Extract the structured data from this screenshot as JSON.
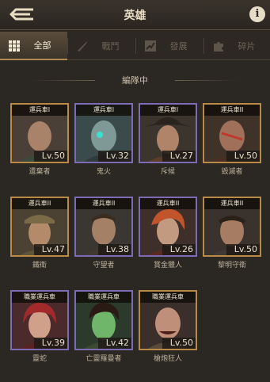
{
  "header": {
    "title": "英雄",
    "info": "i"
  },
  "tabs": [
    {
      "label": "全部",
      "icon": "grid-icon",
      "active": true
    },
    {
      "label": "戰鬥",
      "icon": "sword-icon",
      "active": false
    },
    {
      "label": "發展",
      "icon": "chart-icon",
      "active": false
    },
    {
      "label": "碎片",
      "icon": "puzzle-icon",
      "active": false
    }
  ],
  "section": {
    "title": "編隊中"
  },
  "heroes": [
    {
      "rank": "運兵車I",
      "level": "Lv.50",
      "name": "遺棄者",
      "frame": "gold"
    },
    {
      "rank": "運兵車I",
      "level": "Lv.32",
      "name": "鬼火",
      "frame": "purple"
    },
    {
      "rank": "運兵車I",
      "level": "Lv.27",
      "name": "斥候",
      "frame": "purple"
    },
    {
      "rank": "運兵車II",
      "level": "Lv.50",
      "name": "毀滅者",
      "frame": "gold"
    },
    {
      "rank": "運兵車II",
      "level": "Lv.47",
      "name": "鐵衛",
      "frame": "gold"
    },
    {
      "rank": "運兵車II",
      "level": "Lv.38",
      "name": "守望者",
      "frame": "purple"
    },
    {
      "rank": "運兵車II",
      "level": "Lv.26",
      "name": "賞金獵人",
      "frame": "purple"
    },
    {
      "rank": "運兵車II",
      "level": "Lv.50",
      "name": "黎明守衛",
      "frame": "gold"
    },
    {
      "rank": "職業運兵車",
      "level": "Lv.39",
      "name": "靈蛇",
      "frame": "purple"
    },
    {
      "rank": "職業運兵車",
      "level": "Lv.42",
      "name": "亡靈羅曼者",
      "frame": "purple"
    },
    {
      "rank": "職業運兵車",
      "level": "Lv.50",
      "name": "槍炮狂人",
      "frame": "gold"
    }
  ]
}
